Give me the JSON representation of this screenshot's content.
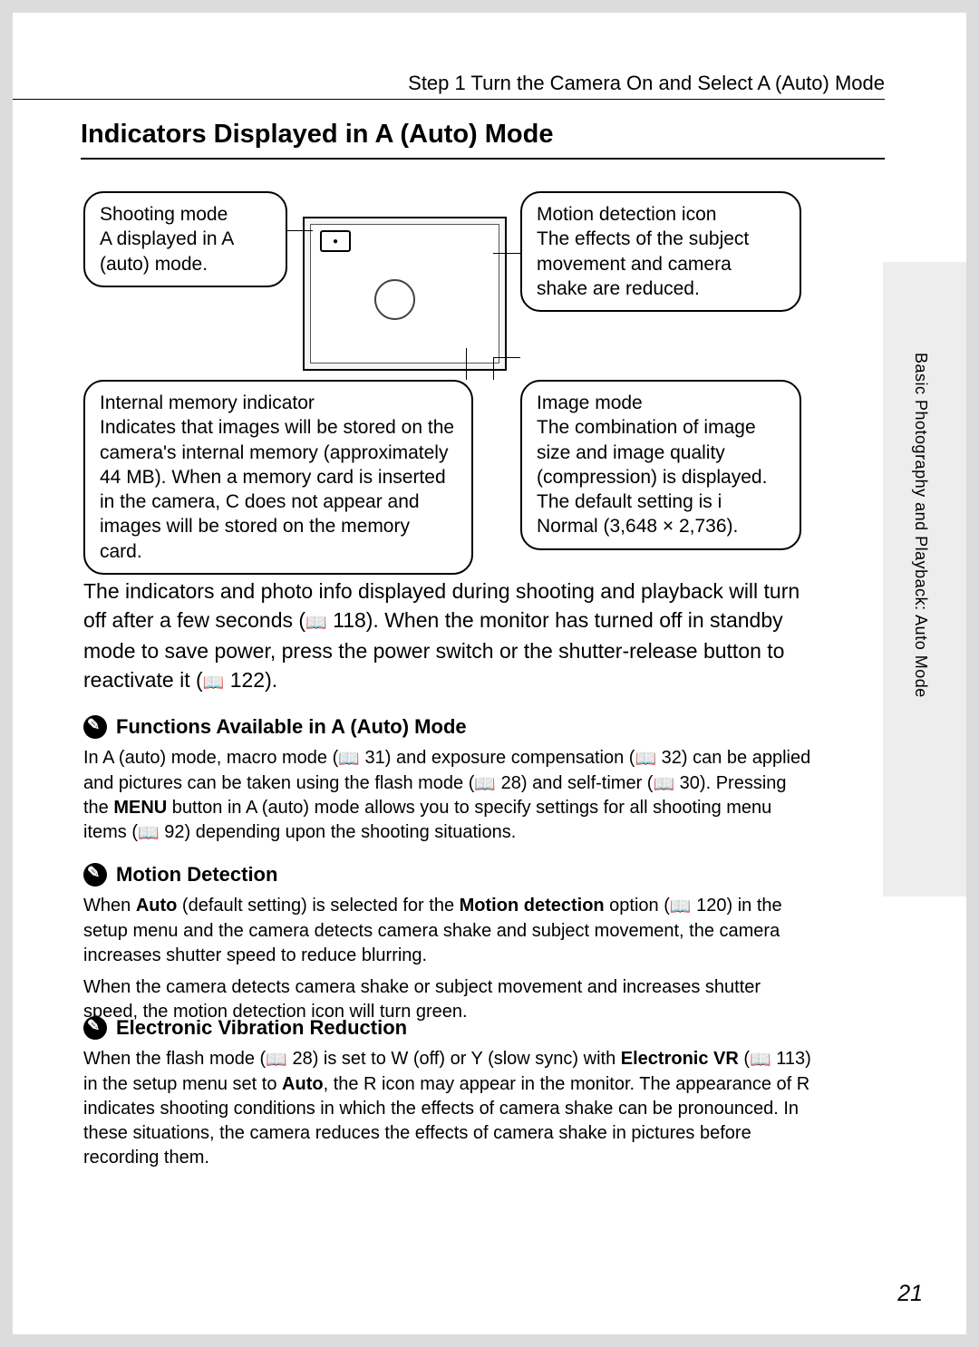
{
  "header": {
    "step_line": "Step 1 Turn the Camera On and Select A   (Auto) Mode"
  },
  "heading": "Indicators Displayed in A   (Auto) Mode",
  "sidebar_label": "Basic Photography and Playback: Auto Mode",
  "callouts": {
    "shooting": "Shooting mode\nA      displayed in A (auto) mode.",
    "motion": "Motion detection icon\nThe effects of the subject movement and camera shake are reduced.",
    "internal": "Internal memory indicator\nIndicates that images will be stored on the camera's internal memory (approximately 44 MB). When a memory card is inserted in the camera, C   does not appear and images will be stored on the memory card.",
    "image_mode": "Image mode\nThe combination of image size and image quality (compression) is displayed. The default setting is i Normal (3,648 × 2,736)."
  },
  "body": {
    "p1a": "The indicators and photo info displayed during shooting and playback will turn off after a few seconds (",
    "p1_ref1": " 118). When the monitor has turned off in standby mode to save power, press the power switch or the shutter-release button to reactivate it (",
    "p1_ref2": " 122)."
  },
  "notes": {
    "functions": {
      "title": "Functions Available in A   (Auto) Mode",
      "body_a": "In A   (auto) mode, macro mode (",
      "ref1": " 31) and exposure compensation (",
      "ref2": " 32) can be applied and pictures can be taken using the flash mode (",
      "ref3": " 28) and self-timer (",
      "ref4": " 30). Pressing the ",
      "menu_label": "MENU",
      "body_b": " button in A   (auto) mode allows you to specify settings for all shooting menu items (",
      "ref5": " 92) depending upon the shooting situations."
    },
    "motion_detection": {
      "title": "Motion Detection",
      "body_a": "When ",
      "auto_label": "Auto",
      "body_b": " (default setting) is selected for the ",
      "md_label": "Motion detection",
      "body_c": " option (",
      "ref1": " 120) in the setup menu and the camera detects camera shake and subject movement, the camera increases shutter speed to reduce blurring.",
      "p2": "When the camera detects camera shake or subject movement and increases shutter speed, the motion detection icon will turn green."
    },
    "evr": {
      "title": "Electronic Vibration Reduction",
      "body_a": "When the flash mode (",
      "ref1": " 28) is set to W (off) or Y     (slow sync) with ",
      "evr_label": "Electronic VR",
      "body_b": " (",
      "ref2": " 113) in the setup menu set to ",
      "auto_label": "Auto",
      "body_c": ", the R   icon may appear in the monitor. The appearance of R   indicates shooting conditions in which the effects of camera shake can be pronounced. In these situations, the camera reduces the effects of camera shake in pictures before recording them."
    }
  },
  "page_number": "21"
}
